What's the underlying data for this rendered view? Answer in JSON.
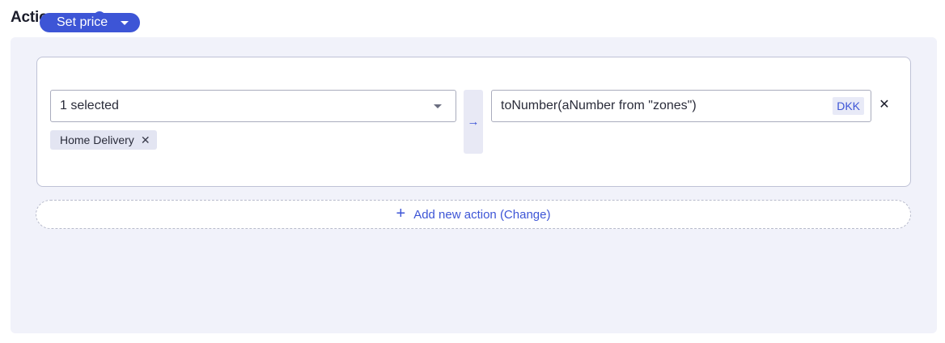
{
  "header": {
    "title": "Actions",
    "required_mark": "★",
    "info_icon": "i"
  },
  "action": {
    "type_label": "Set price",
    "target_select": {
      "value": "1 selected"
    },
    "chips": [
      {
        "label": "Home Delivery",
        "remove_glyph": "✕"
      }
    ],
    "arrow_glyph": "→",
    "expression": {
      "value": "toNumber(aNumber from \"zones\")",
      "currency": "DKK"
    },
    "remove_glyph": "✕"
  },
  "add_action": {
    "plus": "+",
    "label": "Add new action (Change)"
  },
  "colors": {
    "accent": "#3d55d6",
    "panel_bg": "#f1f2fa",
    "required": "#e2454c"
  }
}
